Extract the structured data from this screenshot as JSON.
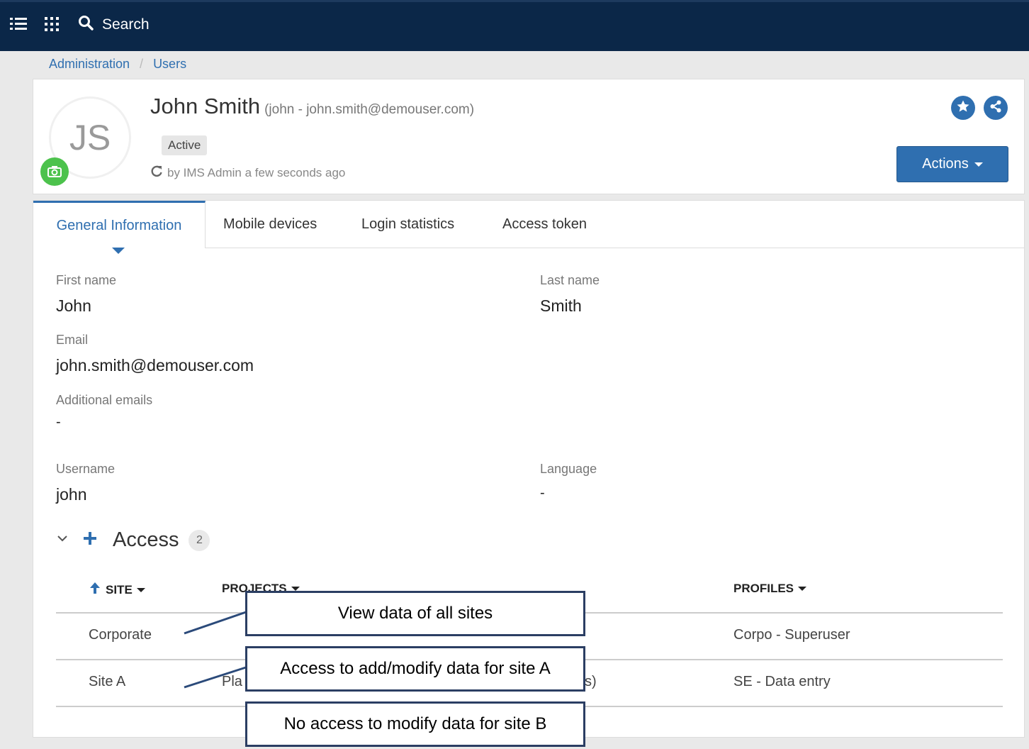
{
  "topbar": {
    "search_label": "Search",
    "icons": [
      "list-icon",
      "apps-grid-icon",
      "search-icon"
    ]
  },
  "breadcrumb": {
    "items": [
      "Administration",
      "Users"
    ]
  },
  "profile": {
    "initials": "JS",
    "name": "John Smith",
    "subtitle": "(john - john.smith@demouser.com)",
    "status": "Active",
    "updated": "by IMS Admin a few seconds ago",
    "actions_label": "Actions"
  },
  "tabs": [
    "General Information",
    "Mobile devices",
    "Login statistics",
    "Access token"
  ],
  "fields": {
    "first_name": {
      "label": "First name",
      "value": "John"
    },
    "last_name": {
      "label": "Last name",
      "value": "Smith"
    },
    "email": {
      "label": "Email",
      "value": "john.smith@demouser.com"
    },
    "additional_emails": {
      "label": "Additional emails",
      "value": "-"
    },
    "username": {
      "label": "Username",
      "value": "john"
    },
    "language": {
      "label": "Language",
      "value": "-"
    }
  },
  "access": {
    "title": "Access",
    "count": "2",
    "columns": {
      "site": "SITE",
      "projects": "PROJECTS",
      "profiles": "PROFILES"
    },
    "rows": [
      {
        "site": "Corporate",
        "projects": "",
        "profiles": "Corpo - Superuser"
      },
      {
        "site": "Site A",
        "projects_left": "Pla",
        "projects_right": "s)",
        "profiles": "SE - Data entry"
      }
    ]
  },
  "callouts": [
    "View data of all sites",
    "Access to add/modify data for site A",
    "No access to modify data for site B"
  ],
  "colors": {
    "navbar": "#0b2748",
    "accent": "#2f6fb0",
    "camera": "#4cc24c",
    "callout_border": "#2b3e63"
  }
}
